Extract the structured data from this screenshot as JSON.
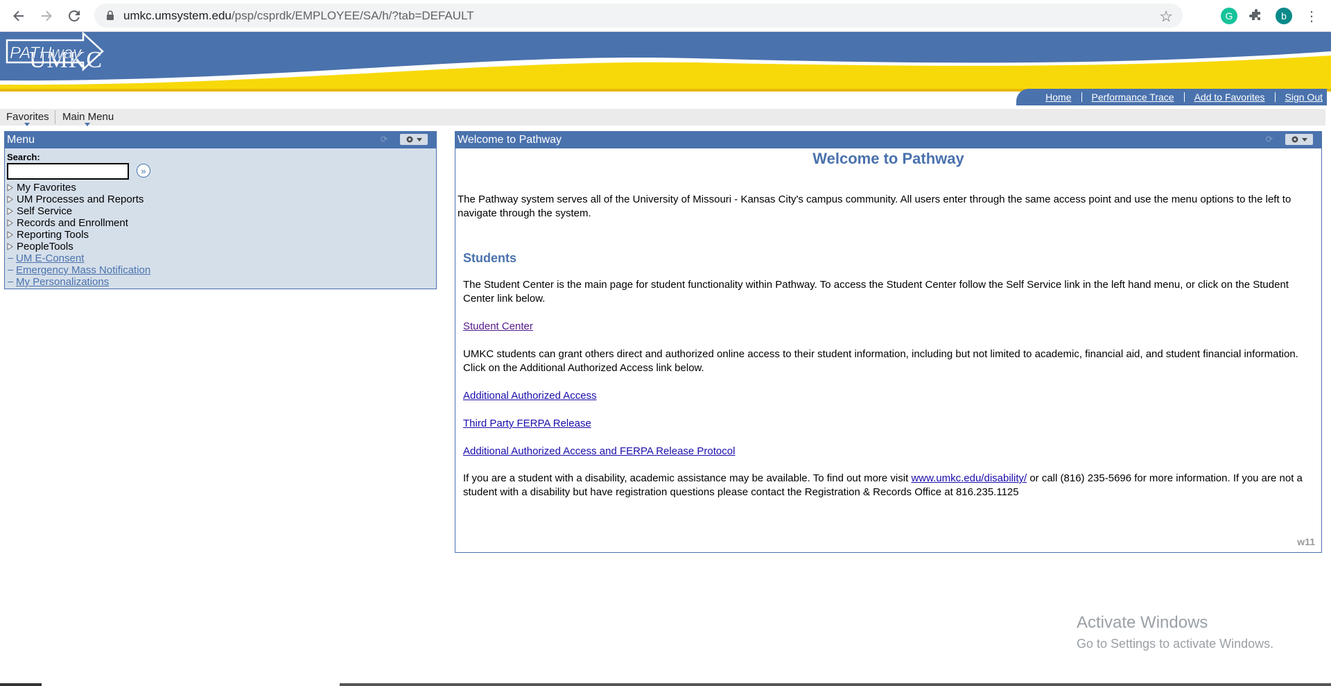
{
  "browser": {
    "url_host": "umkc.umsystem.edu",
    "url_path": "/psp/csprdk/EMPLOYEE/SA/h/?tab=DEFAULT",
    "profile_initial": "b",
    "icons": [
      "back-icon",
      "forward-icon",
      "reload-icon",
      "lock-icon",
      "star-icon",
      "grammarly-icon",
      "puzzle-icon",
      "kebab-menu-icon"
    ]
  },
  "banner": {
    "left_logo": "UMKC",
    "right_logo": "PATHway",
    "colors": {
      "blue": "#4a72ad",
      "yellow": "#f7d90a"
    }
  },
  "header_links": [
    "Home",
    "Performance Trace",
    "Add to Favorites",
    "Sign Out"
  ],
  "menubar": {
    "favorites": "Favorites",
    "main_menu": "Main Menu"
  },
  "menu_pagelet": {
    "title": "Menu",
    "search_label": "Search:",
    "search_value": "",
    "folders": [
      "My Favorites",
      "UM Processes and Reports",
      "Self Service",
      "Records and Enrollment",
      "Reporting Tools",
      "PeopleTools"
    ],
    "links": [
      "UM E-Consent",
      "Emergency Mass Notification",
      "My Personalizations"
    ]
  },
  "welcome_pagelet": {
    "header": "Welcome to Pathway",
    "title": "Welcome to Pathway",
    "intro": "The Pathway system serves all of the University of Missouri - Kansas City's campus community. All users enter through the same access point and use the menu options to the left to navigate through the system.",
    "students_heading": "Students",
    "student_center_text": "The Student Center is the main page for student functionality within Pathway. To access the Student Center follow the Self Service link in the left hand menu, or click on the Student Center link below.",
    "student_center_link": "Student Center",
    "access_text": "UMKC students can grant others direct and authorized online access to their student information, including but not limited to academic, financial aid, and student financial information. Click on the Additional Authorized Access link below.",
    "access_link": "Additional Authorized Access",
    "ferpa_link": "Third Party FERPA Release",
    "protocol_link": "Additional Authorized Access and FERPA Release Protocol",
    "disability_text_before": "If you are a student with a disability, academic assistance may be available. To find out more visit ",
    "disability_link": "www.umkc.edu/disability/",
    "disability_text_after": " or call (816) 235-5696 for more information. If you are not a student with a disability but have registration questions please contact the Registration & Records Office at 816.235.1125",
    "footer_code": "w11"
  },
  "watermark": {
    "line1": "Activate Windows",
    "line2": "Go to Settings to activate Windows."
  }
}
